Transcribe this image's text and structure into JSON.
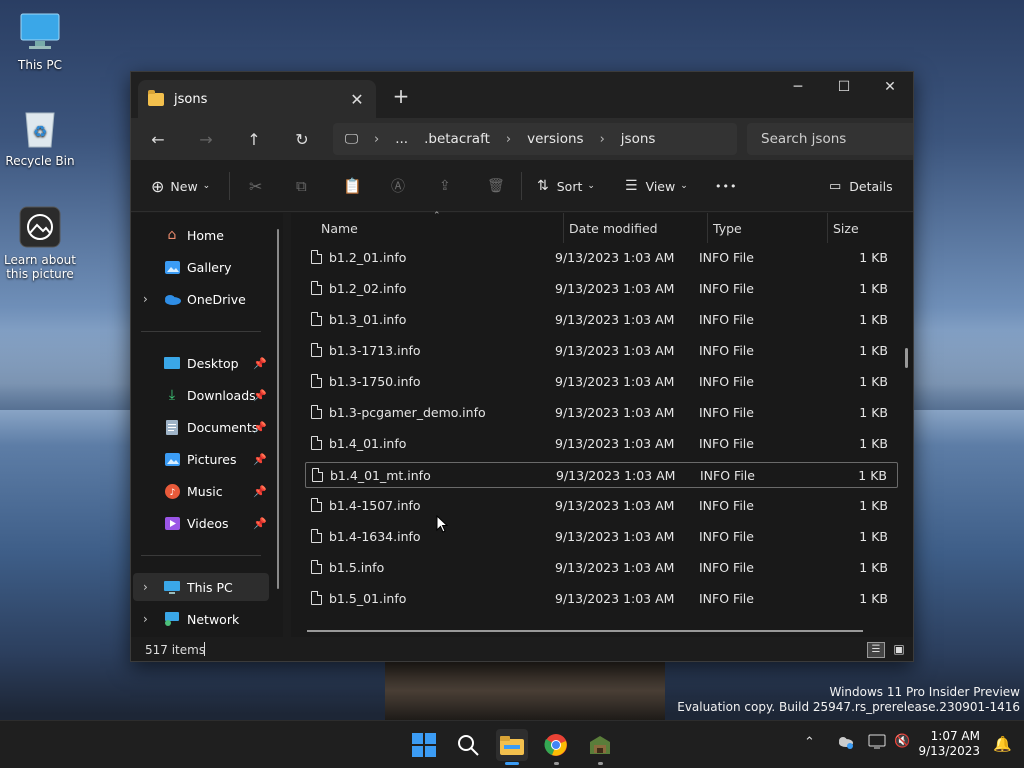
{
  "desktop": {
    "icons": [
      {
        "label": "This PC"
      },
      {
        "label": "Recycle Bin"
      },
      {
        "label": "Learn about this picture"
      }
    ]
  },
  "window": {
    "tab_title": "jsons",
    "new_tab": "+",
    "breadcrumb": [
      "...",
      ".betacraft",
      "versions",
      "jsons"
    ],
    "search_placeholder": "Search jsons",
    "toolbar": {
      "new_label": "New",
      "sort_label": "Sort",
      "view_label": "View",
      "more_label": "•••",
      "details_label": "Details"
    },
    "sidebar": {
      "items": [
        {
          "label": "Home"
        },
        {
          "label": "Gallery"
        },
        {
          "label": "OneDrive"
        },
        {
          "label": "Desktop"
        },
        {
          "label": "Downloads"
        },
        {
          "label": "Documents"
        },
        {
          "label": "Pictures"
        },
        {
          "label": "Music"
        },
        {
          "label": "Videos"
        },
        {
          "label": "This PC"
        },
        {
          "label": "Network"
        }
      ]
    },
    "columns": {
      "name": "Name",
      "date": "Date modified",
      "type": "Type",
      "size": "Size"
    },
    "files": [
      {
        "name": "b1.2_01.info",
        "date": "9/13/2023 1:03 AM",
        "type": "INFO File",
        "size": "1 KB"
      },
      {
        "name": "b1.2_02.info",
        "date": "9/13/2023 1:03 AM",
        "type": "INFO File",
        "size": "1 KB"
      },
      {
        "name": "b1.3_01.info",
        "date": "9/13/2023 1:03 AM",
        "type": "INFO File",
        "size": "1 KB"
      },
      {
        "name": "b1.3-1713.info",
        "date": "9/13/2023 1:03 AM",
        "type": "INFO File",
        "size": "1 KB"
      },
      {
        "name": "b1.3-1750.info",
        "date": "9/13/2023 1:03 AM",
        "type": "INFO File",
        "size": "1 KB"
      },
      {
        "name": "b1.3-pcgamer_demo.info",
        "date": "9/13/2023 1:03 AM",
        "type": "INFO File",
        "size": "1 KB"
      },
      {
        "name": "b1.4_01.info",
        "date": "9/13/2023 1:03 AM",
        "type": "INFO File",
        "size": "1 KB"
      },
      {
        "name": "b1.4_01_mt.info",
        "date": "9/13/2023 1:03 AM",
        "type": "INFO File",
        "size": "1 KB"
      },
      {
        "name": "b1.4-1507.info",
        "date": "9/13/2023 1:03 AM",
        "type": "INFO File",
        "size": "1 KB"
      },
      {
        "name": "b1.4-1634.info",
        "date": "9/13/2023 1:03 AM",
        "type": "INFO File",
        "size": "1 KB"
      },
      {
        "name": "b1.5.info",
        "date": "9/13/2023 1:03 AM",
        "type": "INFO File",
        "size": "1 KB"
      },
      {
        "name": "b1.5_01.info",
        "date": "9/13/2023 1:03 AM",
        "type": "INFO File",
        "size": "1 KB"
      }
    ],
    "status_text": "517 items"
  },
  "watermark": {
    "line1": "Windows 11 Pro Insider Preview",
    "line2": "Evaluation copy. Build 25947.rs_prerelease.230901-1416"
  },
  "taskbar": {
    "time": "1:07 AM",
    "date": "9/13/2023"
  },
  "colors": {
    "window_bg": "#1c1c1c",
    "folder_yellow": "#f3c04d",
    "accent_blue": "#3b9cf5"
  }
}
